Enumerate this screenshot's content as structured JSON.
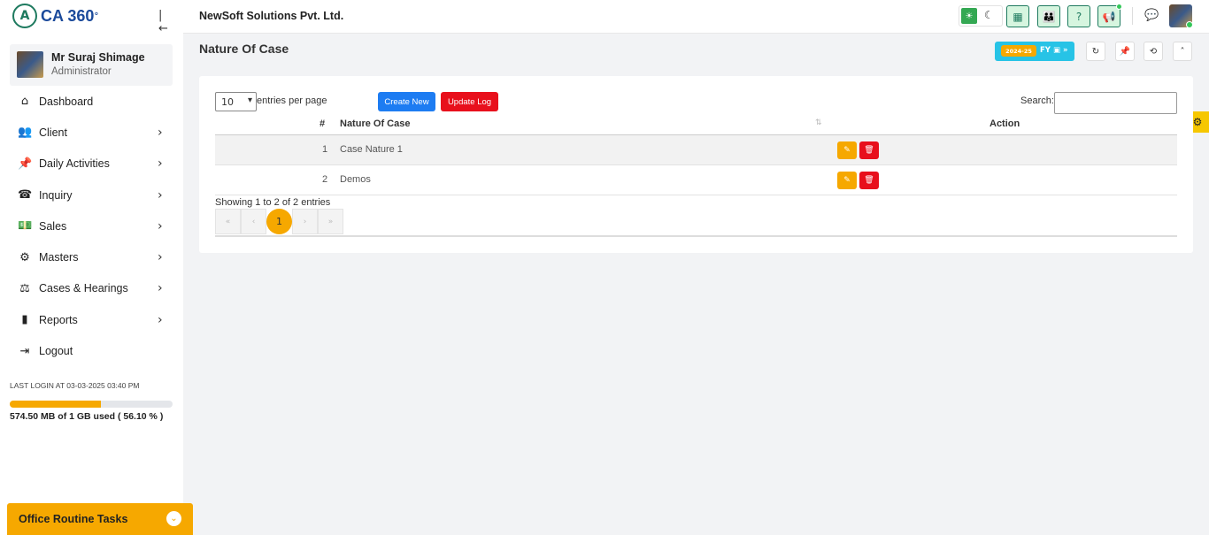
{
  "app": {
    "logo_text": "CA 360",
    "logo_sup": "°"
  },
  "user": {
    "name": "Mr Suraj Shimage",
    "role": "Administrator"
  },
  "sidebar": {
    "items": [
      {
        "label": "Dashboard",
        "icon": "home-icon",
        "glyph": "⌂",
        "has_children": false
      },
      {
        "label": "Client",
        "icon": "users-icon",
        "glyph": "👥",
        "has_children": true
      },
      {
        "label": "Daily Activities",
        "icon": "pin-icon",
        "glyph": "📌",
        "has_children": true
      },
      {
        "label": "Inquiry",
        "icon": "phone-icon",
        "glyph": "☎",
        "has_children": true
      },
      {
        "label": "Sales",
        "icon": "money-icon",
        "glyph": "💵",
        "has_children": true
      },
      {
        "label": "Masters",
        "icon": "gears-icon",
        "glyph": "⚙",
        "has_children": true
      },
      {
        "label": "Cases & Hearings",
        "icon": "scale-icon",
        "glyph": "⚖",
        "has_children": true
      },
      {
        "label": "Reports",
        "icon": "file-icon",
        "glyph": "▮",
        "has_children": true
      },
      {
        "label": "Logout",
        "icon": "logout-icon",
        "glyph": "⇥",
        "has_children": false
      }
    ],
    "last_login": "LAST LOGIN AT 03-03-2025 03:40 PM",
    "storage_text": "574.50 MB of 1 GB used ( 56.10 % )",
    "storage_percent": 56.1,
    "routine_label": "Office Routine Tasks"
  },
  "header": {
    "company": "NewSoft Solutions Pvt. Ltd."
  },
  "page": {
    "title": "Nature Of Case",
    "fy_year": "2024-25",
    "fy_label": "FY"
  },
  "table_controls": {
    "entries_value": "10",
    "entries_text": "entries per page",
    "create_label": "Create New",
    "update_log_label": "Update Log",
    "search_label": "Search:"
  },
  "table": {
    "columns": [
      "#",
      "Nature Of Case",
      "Action"
    ],
    "rows": [
      {
        "index": "1",
        "name": "Case Nature 1"
      },
      {
        "index": "2",
        "name": "Demos"
      }
    ]
  },
  "footer": {
    "showing": "Showing 1 to 2 of 2 entries",
    "pages": [
      "«",
      "‹",
      "1",
      "›",
      "»"
    ]
  },
  "colors": {
    "accent": "#f6a800",
    "primary": "#1d7cf2",
    "danger": "#e8101c",
    "brand_green": "#1e7a5f"
  }
}
